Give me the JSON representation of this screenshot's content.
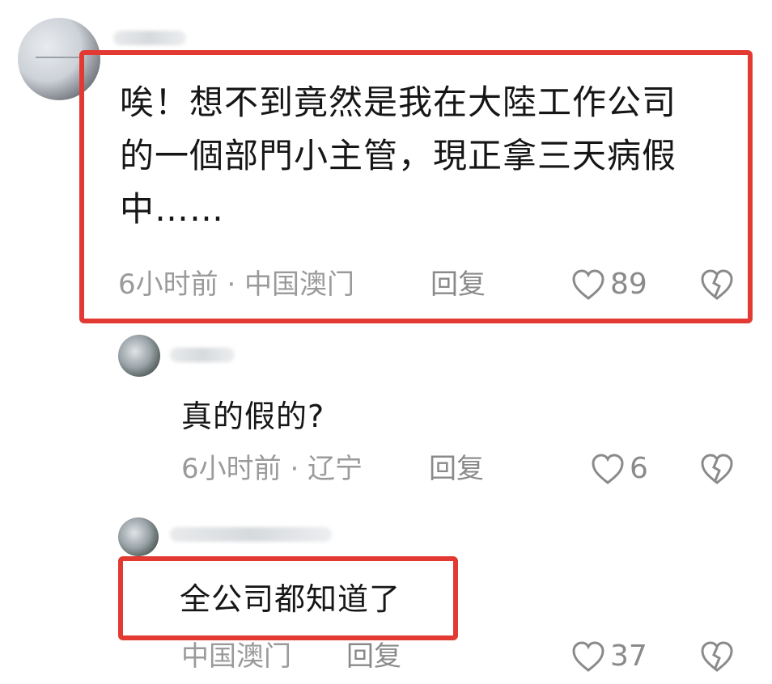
{
  "comments": [
    {
      "lines": [
        "唉！想不到竟然是我在大陸工作公司",
        "的一個部門小主管，現正拿三天病假",
        "中……"
      ],
      "meta": "6小时前 · 中国澳门",
      "reply_label": "回复",
      "likes": "89"
    },
    {
      "text": "真的假的?",
      "meta": "6小时前 · 辽宁",
      "reply_label": "回复",
      "likes": "6"
    },
    {
      "text": "全公司都知道了",
      "meta": "中国澳门",
      "reply_label": "回复",
      "likes": "37"
    }
  ],
  "colors": {
    "highlight": "#e23a32",
    "meta": "#9a9a9a",
    "text": "#161616"
  },
  "icons": {
    "like": "heart-outline-icon",
    "dislike": "broken-heart-icon"
  }
}
